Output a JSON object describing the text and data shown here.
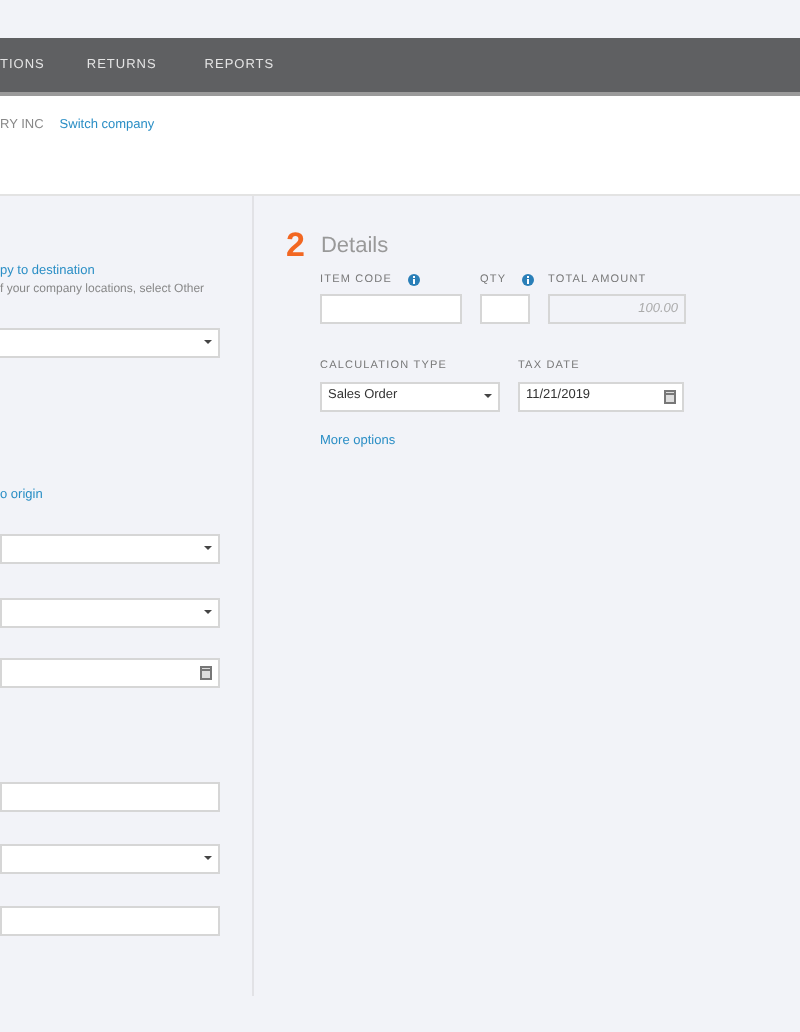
{
  "nav": {
    "items": [
      "TIONS",
      "RETURNS",
      "REPORTS"
    ]
  },
  "company": {
    "name": "RY INC",
    "switch_link": "Switch company"
  },
  "origin_panel": {
    "copy_link": "py to destination",
    "hint": "f your company locations, select Other",
    "fields": [
      {
        "kind": "select"
      }
    ],
    "copy_back_link": "o origin",
    "fields_2": [
      {
        "kind": "select"
      },
      {
        "kind": "select"
      },
      {
        "kind": "date"
      },
      {
        "kind": "spacer"
      },
      {
        "kind": "text"
      },
      {
        "kind": "select"
      },
      {
        "kind": "text"
      }
    ]
  },
  "details": {
    "step": "2",
    "title": "Details",
    "row_1": [
      {
        "label": "ITEM CODE",
        "info": true,
        "kind": "text"
      },
      {
        "label": "QTY",
        "info": true,
        "kind": "text"
      },
      {
        "label": "TOTAL AMOUNT",
        "info": false,
        "kind": "amount",
        "placeholder": "100.00"
      }
    ],
    "row_2": [
      {
        "label": "CALCULATION TYPE",
        "kind": "select",
        "value": "Sales Order"
      },
      {
        "label": "TAX DATE",
        "kind": "date",
        "value": "11/21/2019"
      }
    ],
    "more_options": "More options"
  }
}
